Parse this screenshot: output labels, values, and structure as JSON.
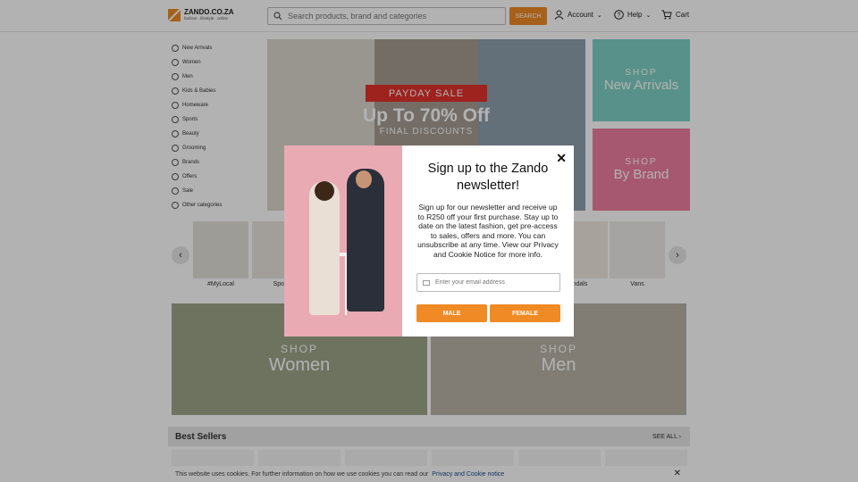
{
  "header": {
    "logo_name": "ZANDO.CO.ZA",
    "logo_tagline": "fashion . lifestyle . online",
    "search_placeholder": "Search products, brand and categories",
    "search_button": "SEARCH",
    "account_label": "Account",
    "help_label": "Help",
    "cart_label": "Cart"
  },
  "sidebar": {
    "items": [
      {
        "label": "New Arrivals",
        "icon": "star-icon"
      },
      {
        "label": "Women",
        "icon": "woman-icon"
      },
      {
        "label": "Men",
        "icon": "shirt-icon"
      },
      {
        "label": "Kids & Babies",
        "icon": "baby-icon"
      },
      {
        "label": "Homeware",
        "icon": "sofa-icon"
      },
      {
        "label": "Sports",
        "icon": "dumbbell-icon"
      },
      {
        "label": "Beauty",
        "icon": "lipstick-icon"
      },
      {
        "label": "Grooming",
        "icon": "razor-icon"
      },
      {
        "label": "Brands",
        "icon": "tag-icon"
      },
      {
        "label": "Offers",
        "icon": "percent-icon"
      },
      {
        "label": "Sale",
        "icon": "sale-icon"
      },
      {
        "label": "Other categories",
        "icon": "plus-circle-icon"
      }
    ]
  },
  "hero": {
    "badge": "PAYDAY SALE",
    "title": "Up To 70% Off",
    "subtitle": "FINAL DISCOUNTS"
  },
  "tiles": {
    "new_arrivals": {
      "shop": "SHOP",
      "label": "New Arrivals",
      "color": "#7fd0c4"
    },
    "by_brand": {
      "shop": "SHOP",
      "label": "By Brand",
      "color": "#f07ea3"
    }
  },
  "carousel": {
    "items": [
      "#MyLocal",
      "Spor",
      "",
      "",
      "",
      "",
      "ndals",
      "Vans"
    ]
  },
  "banners": {
    "women": {
      "shop": "SHOP",
      "label": "Women"
    },
    "men": {
      "shop": "SHOP",
      "label": "Men"
    }
  },
  "bestsellers": {
    "title": "Best Sellers",
    "see_all": "SEE ALL"
  },
  "cookie": {
    "text": "This website uses cookies. For further information on how we use cookies you can read our",
    "link": "Privacy and Cookie notice"
  },
  "modal": {
    "title": "Sign up to the Zando newsletter!",
    "text": "Sign up for our newsletter and receive up to R250 off your first purchase. Stay up to date on the latest fashion, get pre-access to sales, offers and more. You can unsubscribe at any time. View our Privacy and Cookie Notice for more info.",
    "email_placeholder": "Enter your email address",
    "male_button": "MALE",
    "female_button": "FEMALE"
  },
  "colors": {
    "accent": "#f08a24",
    "sale_red": "#e3312b"
  }
}
